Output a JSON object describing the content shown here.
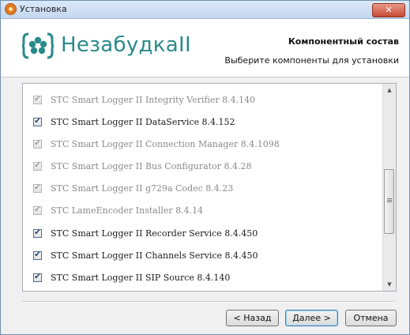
{
  "window": {
    "title": "Установка",
    "close_glyph": "✕"
  },
  "header": {
    "logo_text": "НезабудкаII",
    "section_title": "Компонентный состав",
    "section_subtitle": "Выберите компоненты для установки"
  },
  "components": [
    {
      "label": "STC Smart Logger II Integrity Verifier 8.4.140",
      "checked": true,
      "disabled": true
    },
    {
      "label": "STC Smart Logger II DataService 8.4.152",
      "checked": true,
      "disabled": false
    },
    {
      "label": "STC Smart Logger II Connection Manager 8.4.1098",
      "checked": true,
      "disabled": true
    },
    {
      "label": "STC Smart Logger II Bus Configurator 8.4.28",
      "checked": true,
      "disabled": true
    },
    {
      "label": "STC Smart Logger II g729a Codec 8.4.23",
      "checked": true,
      "disabled": true
    },
    {
      "label": "STC LameEncoder Installer 8.4.14",
      "checked": true,
      "disabled": true
    },
    {
      "label": "STC Smart Logger II Recorder Service 8.4.450",
      "checked": true,
      "disabled": false
    },
    {
      "label": "STC Smart Logger II Channels Service 8.4.450",
      "checked": true,
      "disabled": false
    },
    {
      "label": "STC Smart Logger II SIP Source 8.4.140",
      "checked": true,
      "disabled": false
    }
  ],
  "buttons": {
    "back": "< Назад",
    "next": "Далее >",
    "cancel": "Отмена"
  },
  "colors": {
    "logo": "#2a8a8a",
    "accent": "#3c7fb1"
  }
}
